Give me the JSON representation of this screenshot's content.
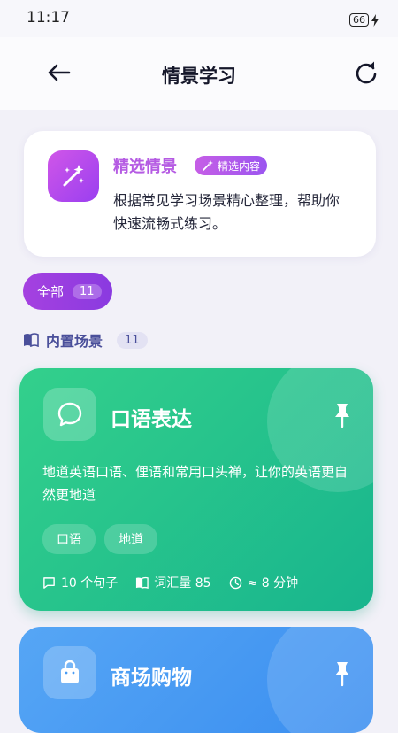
{
  "status": {
    "time": "11:17",
    "battery": "66"
  },
  "header": {
    "title": "情景学习",
    "back_icon": "arrow-left-icon",
    "refresh_icon": "refresh-icon"
  },
  "info": {
    "title": "精选情景",
    "badge": "精选内容",
    "description": "根据常见学习场景精心整理，帮助你快速流畅式练习。",
    "icon": "magic-wand-icon"
  },
  "filter": {
    "label": "全部",
    "count": "11"
  },
  "section": {
    "title": "内置场景",
    "count": "11",
    "icon": "book-icon"
  },
  "cards": [
    {
      "title": "口语表达",
      "icon": "chat-bubble-icon",
      "description": "地道英语口语、俚语和常用口头禅，让你的英语更自然更地道",
      "tags": [
        "口语",
        "地道"
      ],
      "sentences": "10 个句子",
      "vocab": "词汇量 85",
      "duration": "≈ 8 分钟",
      "color": "#22c08c"
    },
    {
      "title": "商场购物",
      "icon": "shopping-bag-icon",
      "color": "#4a9cf3"
    }
  ],
  "colors": {
    "accent": "#9a3fe6",
    "section": "#4a4f9a"
  }
}
